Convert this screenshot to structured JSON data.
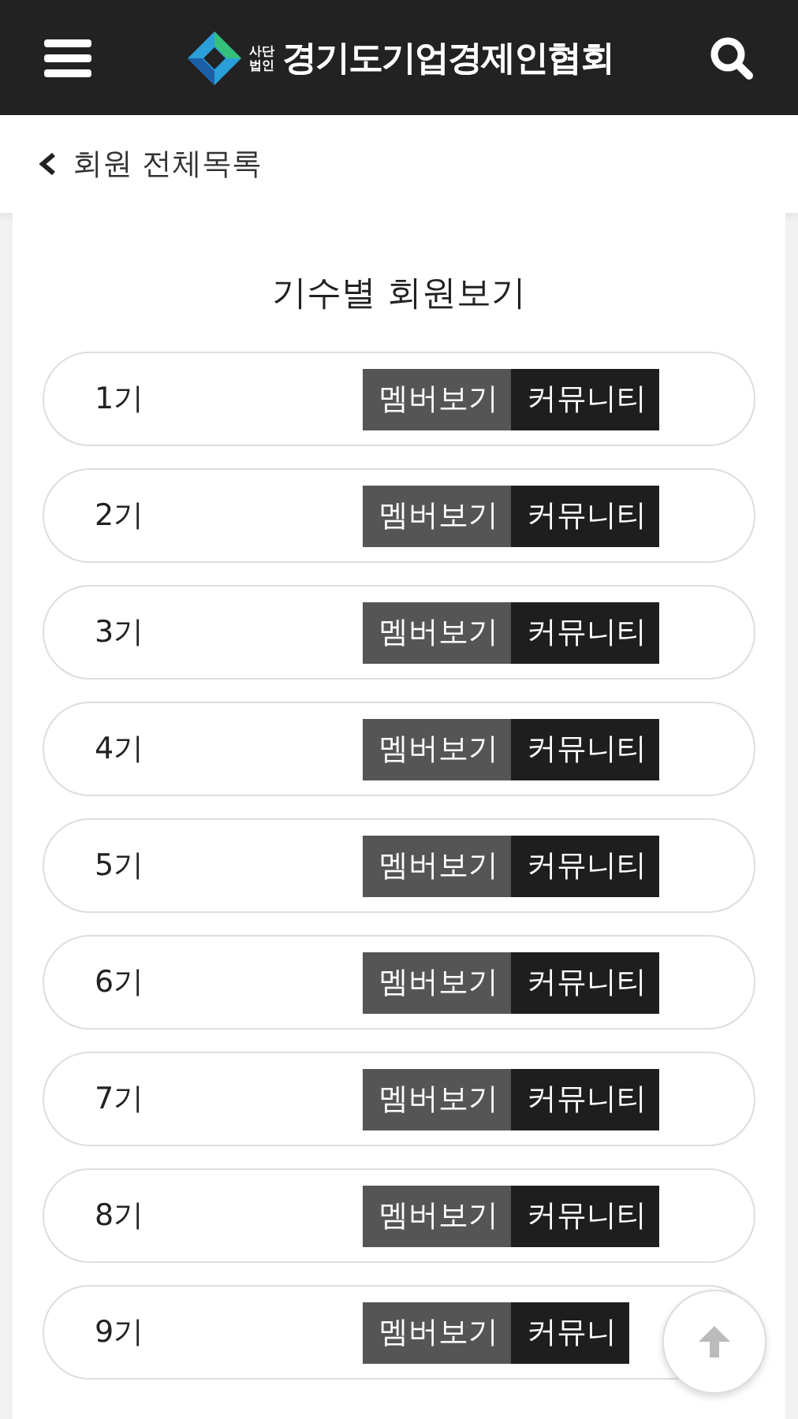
{
  "header": {
    "logo_small": [
      "사단",
      "법인"
    ],
    "title": "경기도기업경제인협회"
  },
  "breadcrumb": {
    "label": "회원 전체목록"
  },
  "section_title": "기수별 회원보기",
  "rows": [
    {
      "label": "1기",
      "buttons": [
        "멤버보기",
        "커뮤니티"
      ]
    },
    {
      "label": "2기",
      "buttons": [
        "멤버보기",
        "커뮤니티"
      ]
    },
    {
      "label": "3기",
      "buttons": [
        "멤버보기",
        "커뮤니티"
      ]
    },
    {
      "label": "4기",
      "buttons": [
        "멤버보기",
        "커뮤니티"
      ]
    },
    {
      "label": "5기",
      "buttons": [
        "멤버보기",
        "커뮤니티"
      ]
    },
    {
      "label": "6기",
      "buttons": [
        "멤버보기",
        "커뮤니티"
      ]
    },
    {
      "label": "7기",
      "buttons": [
        "멤버보기",
        "커뮤니티"
      ]
    },
    {
      "label": "8기",
      "buttons": [
        "멤버보기",
        "커뮤니티"
      ]
    },
    {
      "label": "9기",
      "buttons": [
        "멤버보기",
        "커뮤니"
      ]
    }
  ]
}
